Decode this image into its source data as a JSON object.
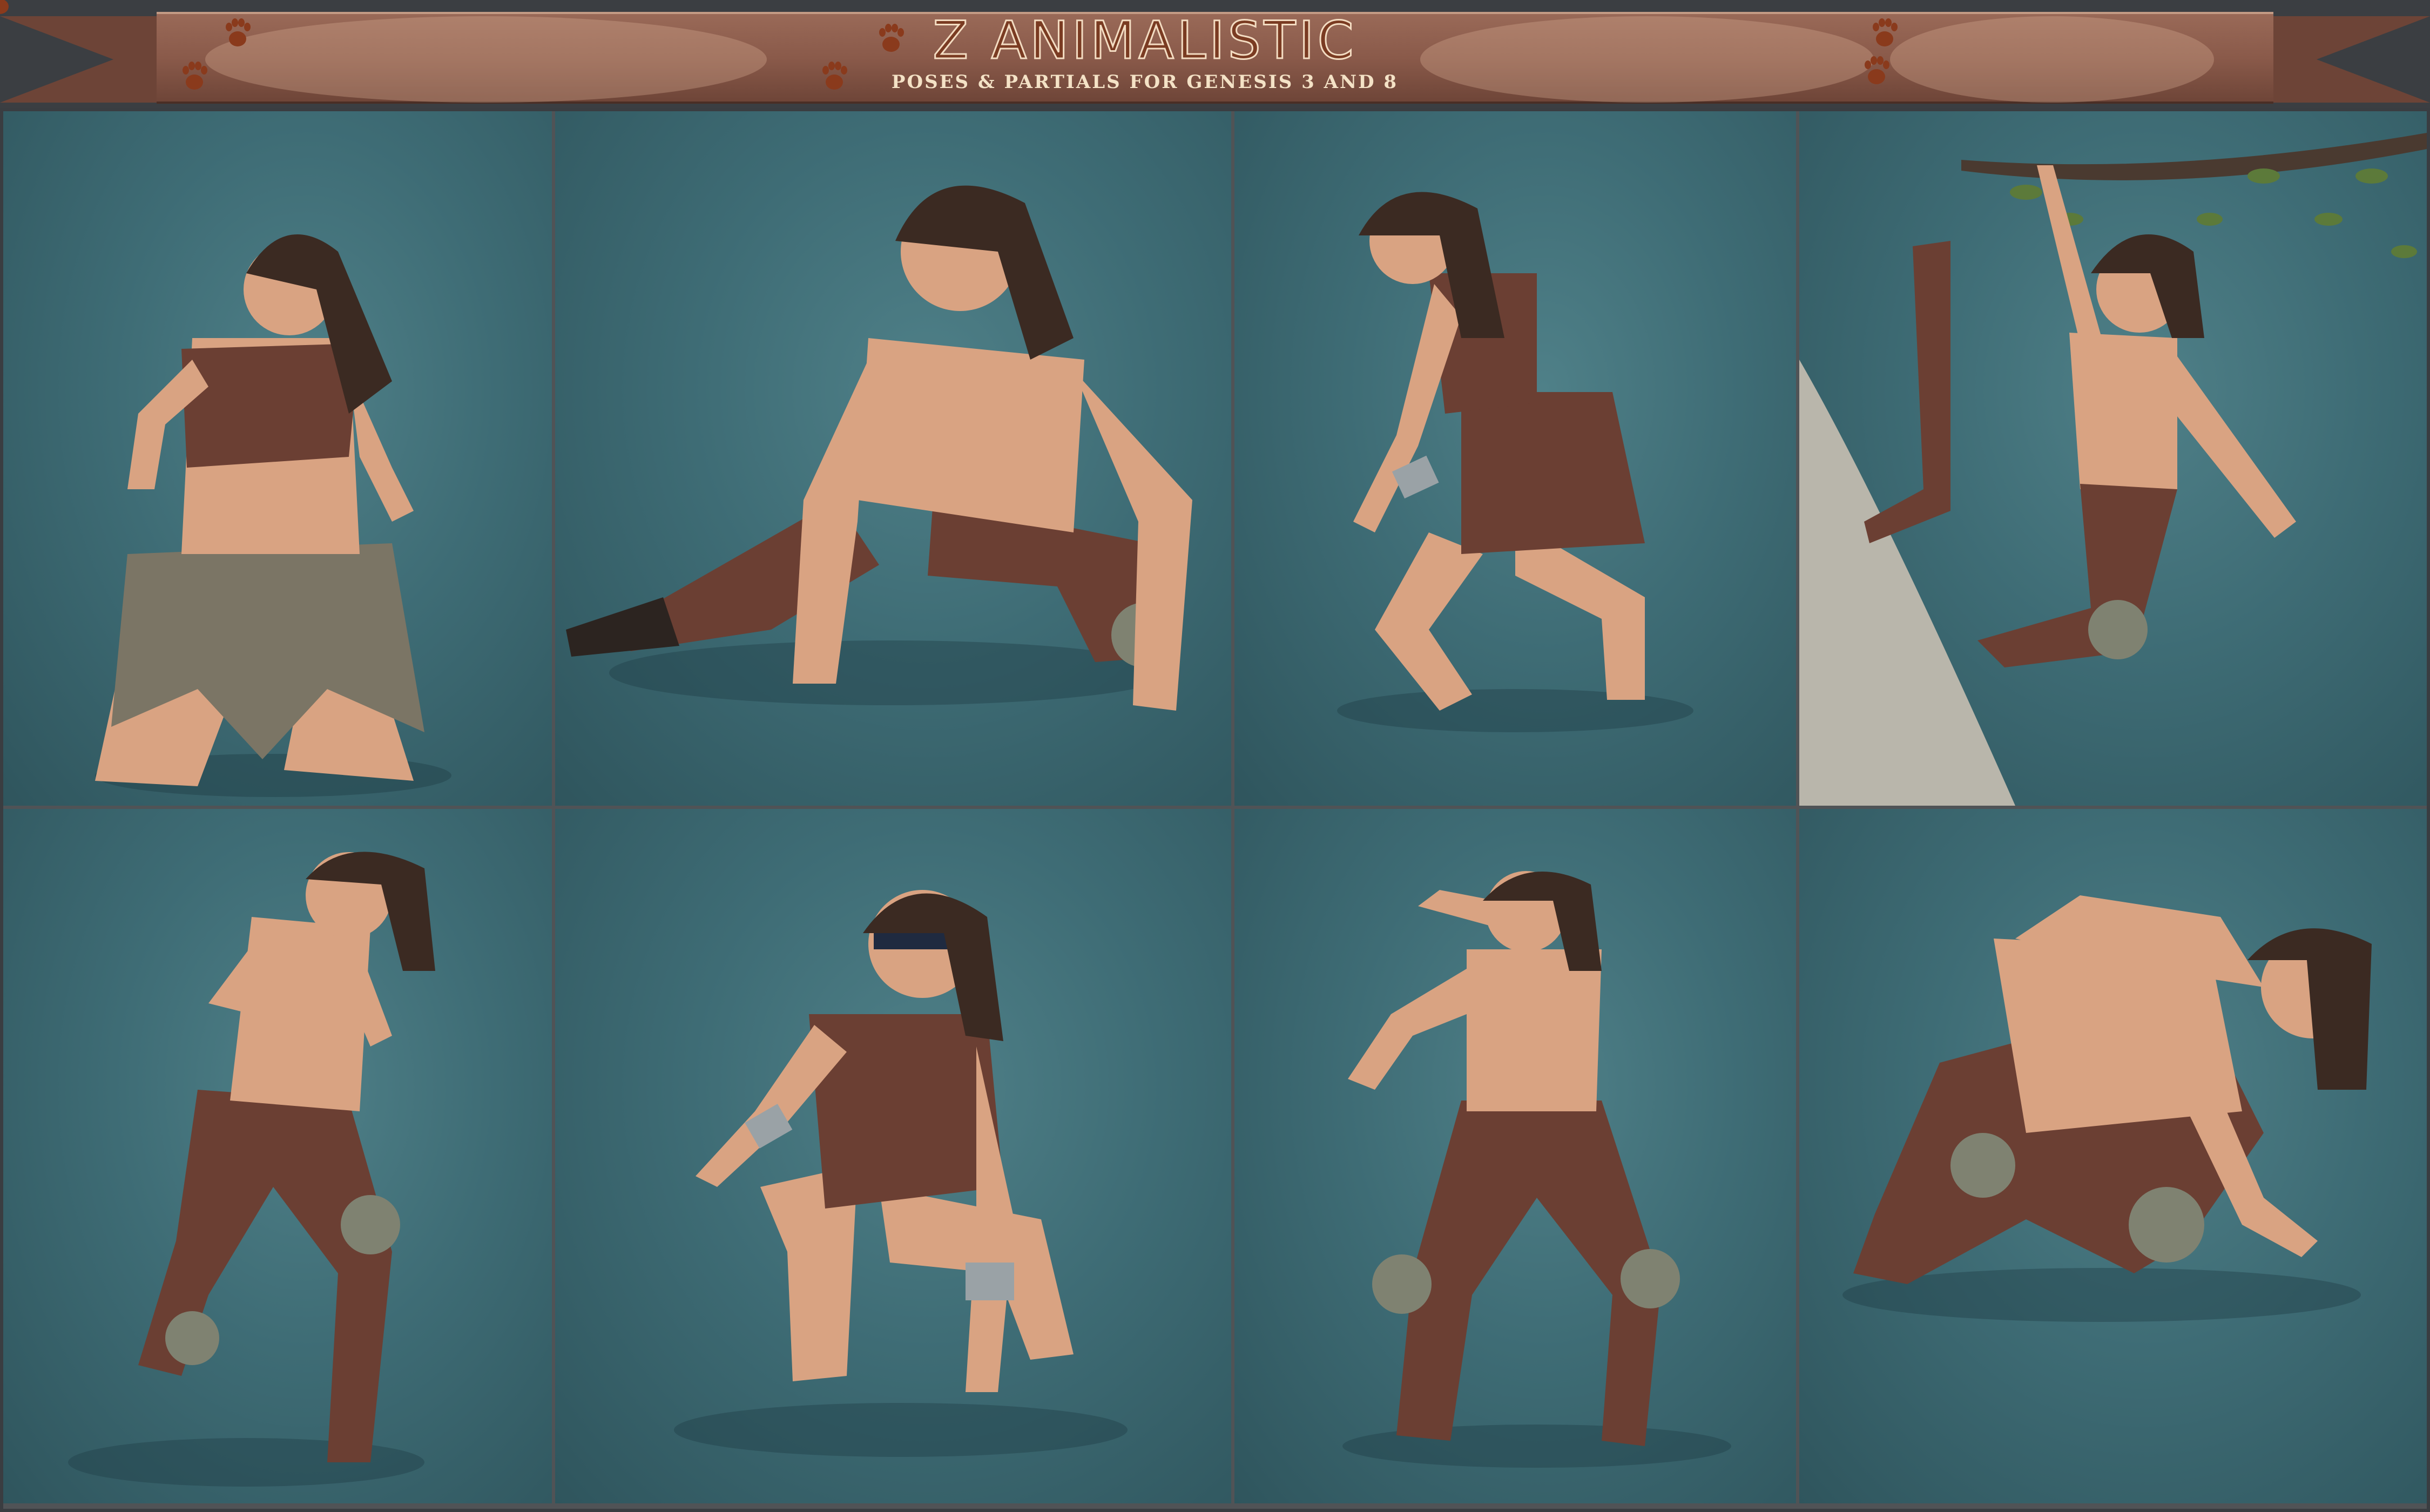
{
  "banner": {
    "title": "Z ANIMALISTIC",
    "subtitle": "POSES & PARTIALS  FOR GENESIS 3 AND 8",
    "colors": {
      "band": "#8a5a4a",
      "title_fill": "#7a3b22",
      "title_outline": "#f3dcc2",
      "paw": "#8a3a1c"
    },
    "icons": [
      "paw-print-icon"
    ]
  },
  "panels": [
    {
      "name": "pose-female-kneeling-howl"
    },
    {
      "name": "pose-male-lunge-crawl"
    },
    {
      "name": "pose-female-crouch-stalk"
    },
    {
      "name": "pose-male-hanging-branch"
    },
    {
      "name": "pose-male-fighting-stance"
    },
    {
      "name": "pose-female-crouch-claw"
    },
    {
      "name": "pose-male-wide-stance-guard"
    },
    {
      "name": "pose-male-low-crouch"
    }
  ],
  "colors": {
    "backdrop": "#3e6c75",
    "skin": "#d9a382",
    "leather": "#6b3f33",
    "hair": "#3b2a22"
  }
}
